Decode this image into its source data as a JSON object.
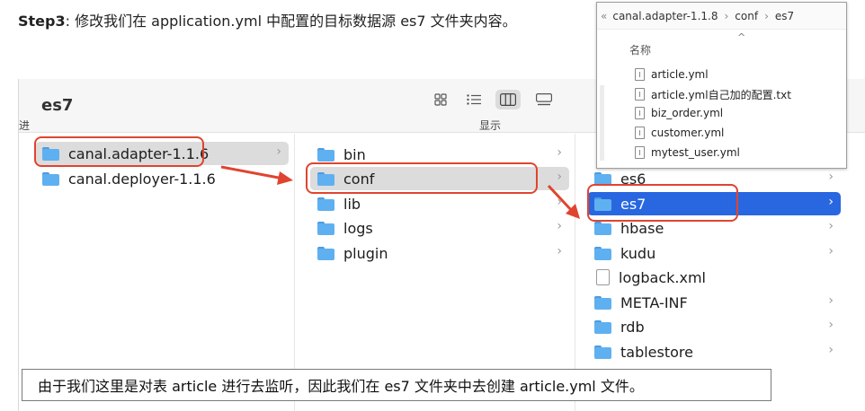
{
  "instruction": {
    "step": "Step3",
    "text": ": 修改我们在 application.yml 中配置的目标数据源 es7 文件夹内容。"
  },
  "finder": {
    "title": "es7",
    "toolbar": {
      "back_label": "进",
      "display_label": "显示",
      "view_icons": [
        "grid-view-icon",
        "list-view-icon",
        "column-view-icon",
        "gallery-view-icon"
      ]
    },
    "column1": [
      {
        "label": "canal.adapter-1.1.6",
        "icon": "folder-icon",
        "chevron": "›"
      },
      {
        "label": "canal.deployer-1.1.6",
        "icon": "folder-icon",
        "chevron": ""
      }
    ],
    "column2": [
      {
        "label": "bin",
        "icon": "folder-icon",
        "chevron": "›"
      },
      {
        "label": "conf",
        "icon": "folder-icon",
        "chevron": "›"
      },
      {
        "label": "lib",
        "icon": "folder-icon",
        "chevron": "›"
      },
      {
        "label": "logs",
        "icon": "folder-icon",
        "chevron": "›"
      },
      {
        "label": "plugin",
        "icon": "folder-icon",
        "chevron": "›"
      }
    ],
    "column3": [
      {
        "label": "es6",
        "icon": "folder-icon",
        "chevron": "›"
      },
      {
        "label": "es7",
        "icon": "folder-icon",
        "chevron": "›"
      },
      {
        "label": "hbase",
        "icon": "folder-icon",
        "chevron": "›"
      },
      {
        "label": "kudu",
        "icon": "folder-icon",
        "chevron": "›"
      },
      {
        "label": "logback.xml",
        "icon": "file-icon",
        "chevron": ""
      },
      {
        "label": "META-INF",
        "icon": "folder-icon",
        "chevron": "›"
      },
      {
        "label": "rdb",
        "icon": "folder-icon",
        "chevron": "›"
      },
      {
        "label": "tablestore",
        "icon": "folder-icon",
        "chevron": "›"
      }
    ]
  },
  "popup": {
    "breadcrumb_prefix": "«",
    "breadcrumb": [
      "canal.adapter-1.1.8",
      "conf",
      "es7"
    ],
    "breadcrumb_sep": "›",
    "sort_caret": "^",
    "column_header": "名称",
    "files": [
      "article.yml",
      "article.yml自己加的配置.txt",
      "biz_order.yml",
      "customer.yml",
      "mytest_user.yml"
    ]
  },
  "caption": "由于我们这里是对表 article 进行去监听，因此我们在  es7 文件夹中去创建 article.yml 文件。",
  "colors": {
    "annotation_red": "#e0442f",
    "selection_blue": "#2867e0",
    "folder_blue": "#5fb0f0"
  }
}
